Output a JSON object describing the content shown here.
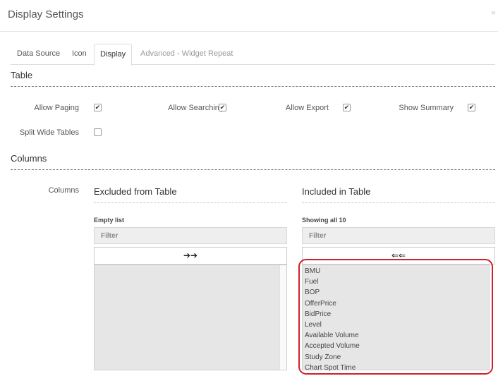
{
  "dialog": {
    "title": "Display Settings",
    "close_icon": "×"
  },
  "tabs": [
    {
      "label": "Data Source"
    },
    {
      "label": "Icon"
    },
    {
      "label": "Display"
    },
    {
      "label": "Advanced - Widget Repeat"
    }
  ],
  "table_section": {
    "heading": "Table",
    "options": [
      {
        "label": "Allow Paging",
        "checked": true
      },
      {
        "label": "Allow Searching",
        "checked": true
      },
      {
        "label": "Allow Export",
        "checked": true
      },
      {
        "label": "Show Summary",
        "checked": true
      },
      {
        "label": "Split Wide Tables",
        "checked": false
      }
    ]
  },
  "columns_section": {
    "heading": "Columns",
    "field_label": "Columns",
    "excluded": {
      "title": "Excluded from Table",
      "status": "Empty list",
      "filter_placeholder": "Filter",
      "move_button": "➔➔",
      "items": []
    },
    "included": {
      "title": "Included in Table",
      "status": "Showing all 10",
      "filter_placeholder": "Filter",
      "move_button": "⇐⇐",
      "items": [
        "BMU",
        "Fuel",
        "BOP",
        "OfferPrice",
        "BidPrice",
        "Level",
        "Available Volume",
        "Accepted Volume",
        "Study Zone",
        "Chart Spot Time"
      ]
    }
  },
  "colors": {
    "highlight": "#d0202a",
    "list_bg": "#e6e6e6",
    "filter_bg": "#eeeeee"
  },
  "check_glyph": "✔"
}
